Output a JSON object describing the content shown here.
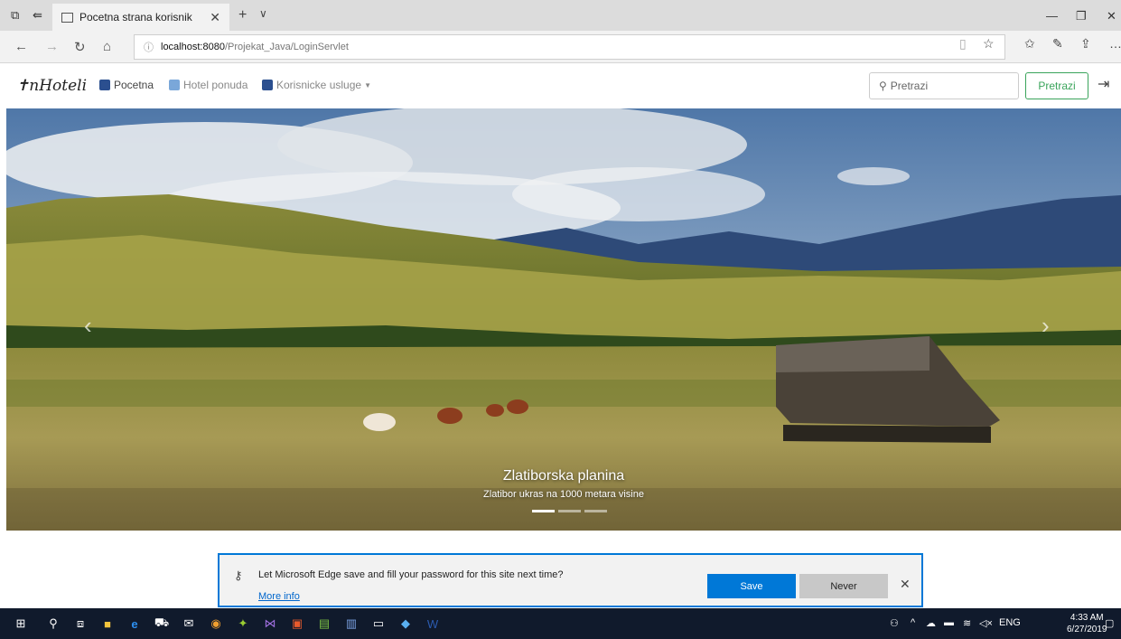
{
  "browser": {
    "tab_title": "Pocetna strana korisnik",
    "url_host": "localhost:8080",
    "url_path": "/Projekat_Java/LoginServlet"
  },
  "navbar": {
    "brand": "nHoteli",
    "links": [
      {
        "label": "Pocetna",
        "icon": "home-icon"
      },
      {
        "label": "Hotel ponuda",
        "icon": "list-icon"
      },
      {
        "label": "Korisnicke usluge",
        "icon": "user-card-icon"
      }
    ],
    "search_placeholder": "Pretrazi",
    "search_button": "Pretrazi"
  },
  "carousel": {
    "title": "Zlatiborska planina",
    "subtitle": "Zlatibor ukras na 1000 metara visine",
    "slide_count": 3,
    "active_slide": 1
  },
  "edge_prompt": {
    "message": "Let Microsoft Edge save and fill your password for this site next time?",
    "more_info": "More info",
    "save": "Save",
    "never": "Never"
  },
  "taskbar": {
    "language": "ENG",
    "time": "4:33 AM",
    "date": "6/27/2019"
  },
  "colors": {
    "accent_green": "#3aa45b",
    "edge_blue": "#0078d7",
    "taskbar": "#101a2c"
  }
}
